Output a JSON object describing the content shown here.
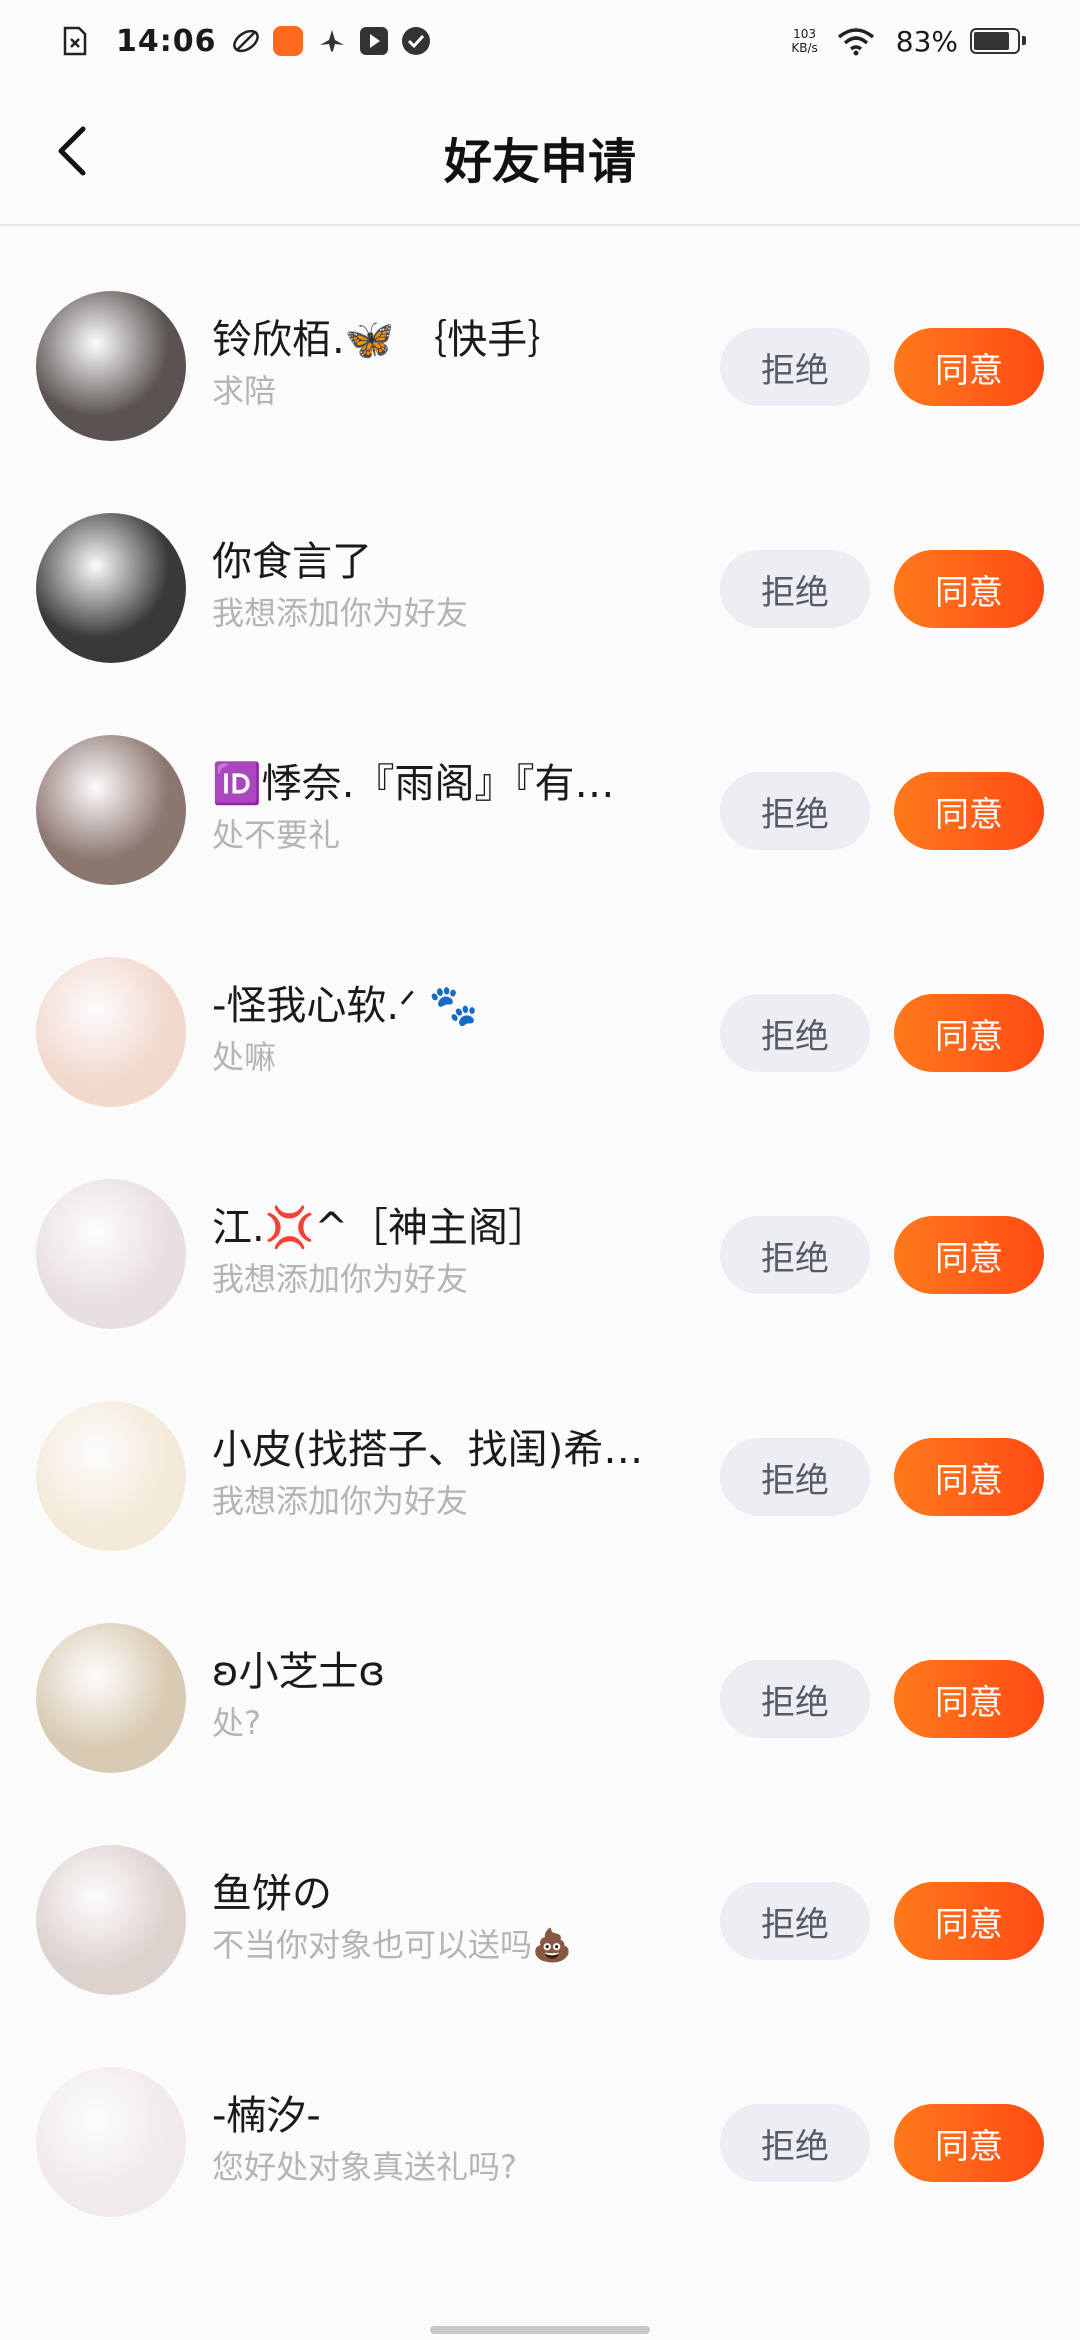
{
  "status_bar": {
    "time": "14:06",
    "net_speed_value": "103",
    "net_speed_unit": "KB/s",
    "battery": "83%",
    "battery_level": 0.83
  },
  "header": {
    "title": "好友申请"
  },
  "buttons": {
    "reject": "拒绝",
    "accept": "同意"
  },
  "requests": [
    {
      "name": "铃欣栢.🦋 ｛快手｝",
      "message": "求陪",
      "avatar_color": "#5a5350"
    },
    {
      "name": "你食言了",
      "message": "我想添加你为好友",
      "avatar_color": "#3b3838"
    },
    {
      "name": "🆔悸奈.『雨阁』『有…",
      "message": "处不要礼",
      "avatar_color": "#8c7670"
    },
    {
      "name": "-怪我心软.ᐟ 🐾",
      "message": "处嘛",
      "avatar_color": "#f1d9cd"
    },
    {
      "name": "江.💢^［神主阁］",
      "message": "我想添加你为好友",
      "avatar_color": "#e8dfe0"
    },
    {
      "name": "小皮(找搭子、找闺)希…",
      "message": "我想添加你为好友",
      "avatar_color": "#f4ead9"
    },
    {
      "name": "ʚ小芝士ɞ",
      "message": "处?",
      "avatar_color": "#d9cbb3"
    },
    {
      "name": "鱼饼の",
      "message": "不当你对象也可以送吗💩",
      "avatar_color": "#ded2cf"
    },
    {
      "name": "-楠汐-",
      "message": "您好处对象真送礼吗?",
      "avatar_color": "#f0eaee"
    }
  ]
}
